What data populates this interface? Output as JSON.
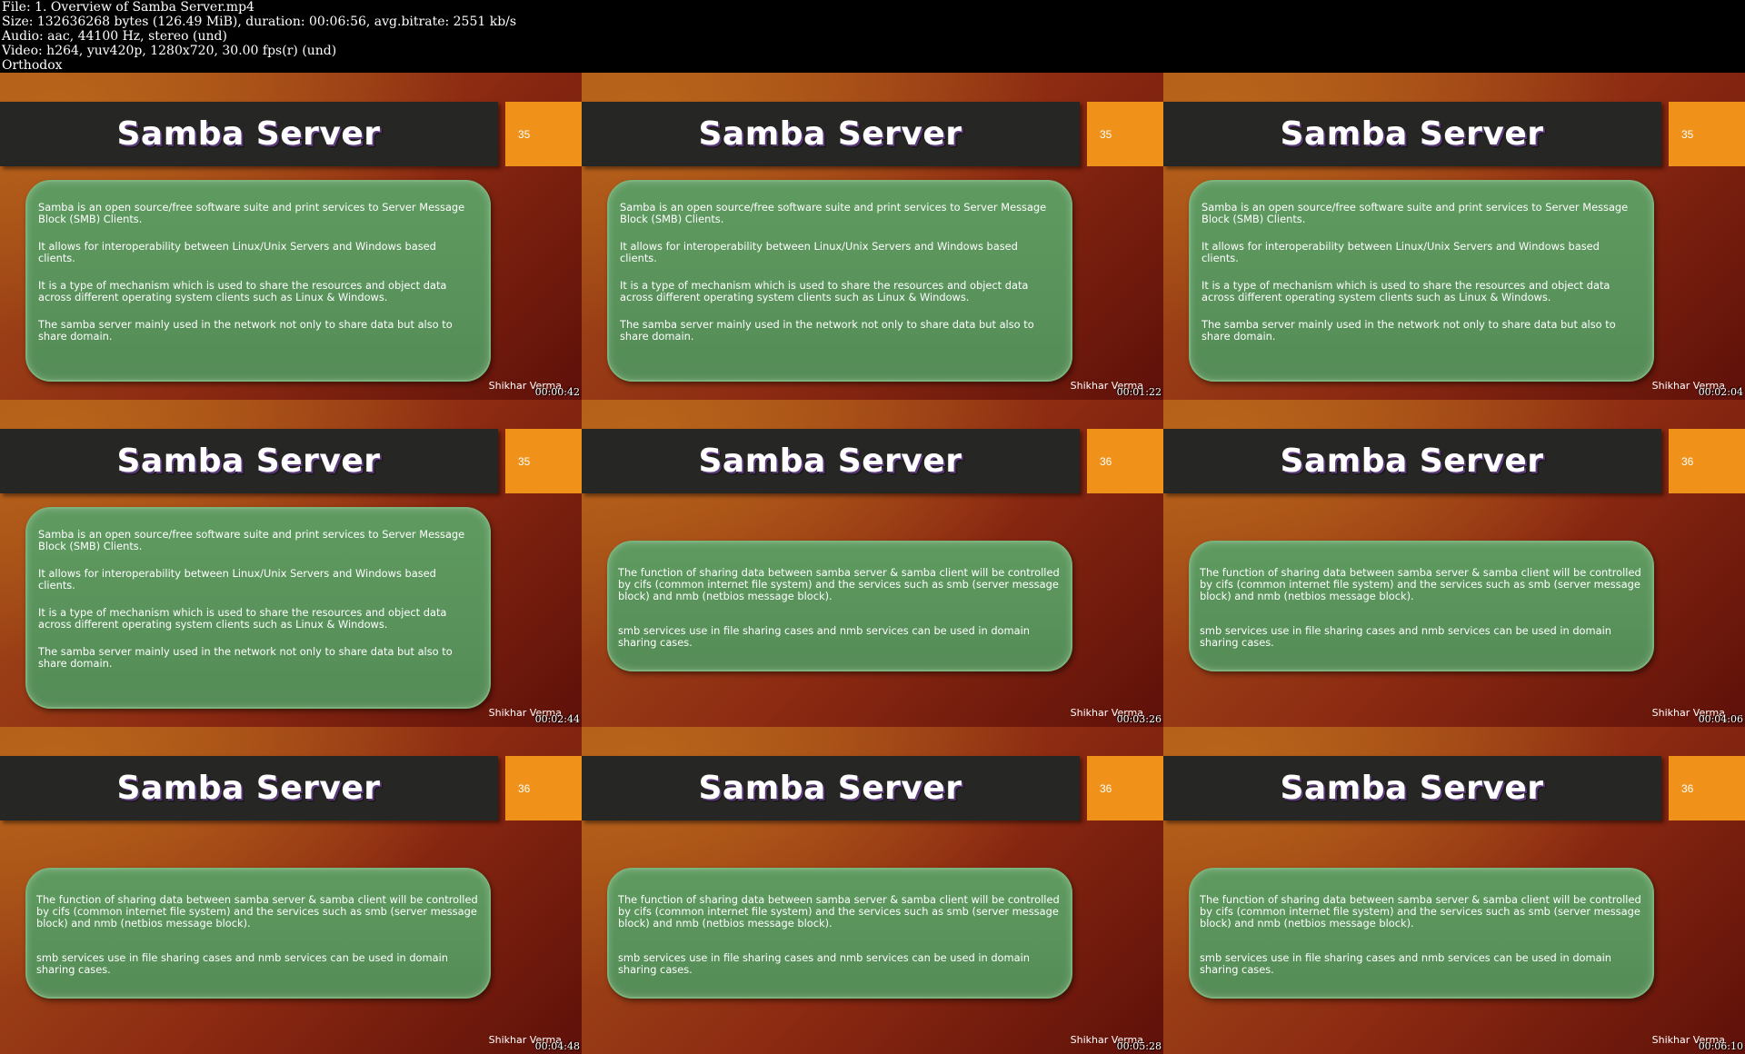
{
  "header": {
    "line1": "File: 1. Overview of Samba Server.mp4",
    "line2": "Size: 132636268 bytes (126.49 MiB), duration: 00:06:56, avg.bitrate: 2551 kb/s",
    "line3": "Audio: aac, 44100 Hz, stereo (und)",
    "line4": "Video: h264, yuv420p, 1280x720, 30.00 fps(r) (und)",
    "line5": "Orthodox"
  },
  "slide_a": {
    "title": "Samba Server",
    "number": "35",
    "p1": "Samba is an open source/free software suite and print services to Server Message Block (SMB) Clients.",
    "p2": "It allows for interoperability between Linux/Unix Servers and Windows based clients.",
    "p3": "It is a type of mechanism which is used to share the resources and object data across different operating system clients such as Linux & Windows.",
    "p4": "The samba server mainly used in the network not only to share data but also to share domain.",
    "author": "Shikhar Verma"
  },
  "slide_b": {
    "title": "Samba Server",
    "number": "36",
    "p1": "The function of sharing data between samba server & samba client will be controlled by cifs (common internet file system) and the services such as smb (server message block) and nmb (netbios message block).",
    "p2": "smb services use in file sharing cases and nmb services can be used in domain sharing cases.",
    "author": "Shikhar Verma"
  },
  "frames": [
    {
      "slide": "a",
      "timestamp": "00:00:42"
    },
    {
      "slide": "a",
      "timestamp": "00:01:22"
    },
    {
      "slide": "a",
      "timestamp": "00:02:04"
    },
    {
      "slide": "a",
      "timestamp": "00:02:44"
    },
    {
      "slide": "b",
      "timestamp": "00:03:26"
    },
    {
      "slide": "b",
      "timestamp": "00:04:06"
    },
    {
      "slide": "b",
      "timestamp": "00:04:48"
    },
    {
      "slide": "b",
      "timestamp": "00:05:28"
    },
    {
      "slide": "b",
      "timestamp": "00:06:10"
    }
  ]
}
